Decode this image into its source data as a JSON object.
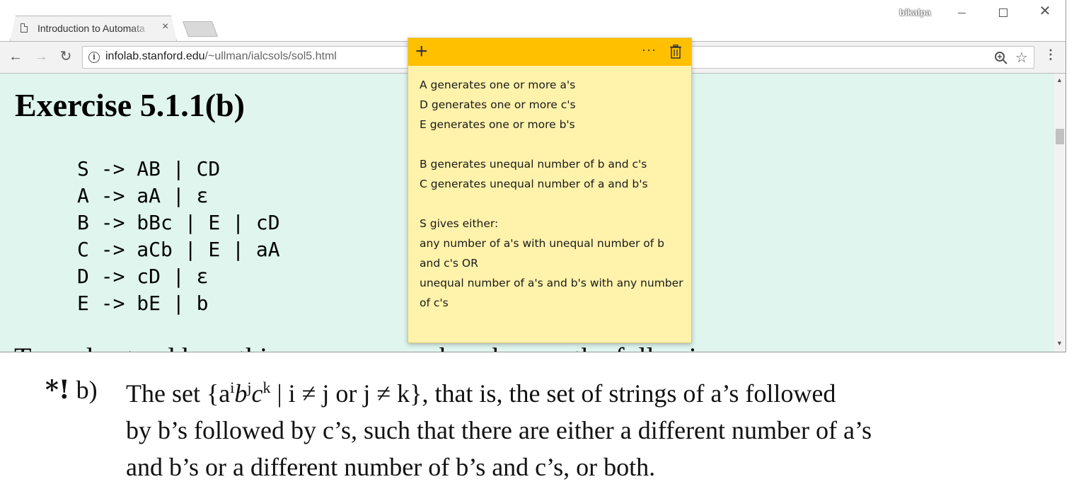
{
  "browser": {
    "tab_title": "Introduction to Automata",
    "tab_close": "×",
    "profile_name": "bikalpa",
    "url_host": "infolab.stanford.edu",
    "url_path": "/~ullman/ialcsols/sol5.html",
    "icons": [
      "back-icon",
      "forward-icon",
      "reload-icon",
      "info-icon",
      "zoom-icon",
      "star-icon",
      "menu-icon"
    ]
  },
  "page": {
    "heading": "Exercise 5.1.1(b)",
    "grammar": [
      "S -> AB | CD",
      "A -> aA | ε",
      "B -> bBc | E | cD",
      "C -> aCb | E | aA",
      "D -> cD | ε",
      "E -> bE | b"
    ],
    "partial_line": "To understand how this grammar works, observe the following:"
  },
  "sticky": {
    "header_color": "#ffc000",
    "body_color": "#fff2ab",
    "lines": [
      "A generates one or more a's",
      "D generates one or more c's",
      "E generates one or more b's",
      "",
      "B generates unequal number of b and c's",
      "C generates unequal number of a and b's",
      "",
      "S gives either:",
      "any number of a's with unequal number of b",
      "and c's OR",
      "unequal number of a's and b's with any number",
      "of c's"
    ]
  },
  "excerpt": {
    "label_marker": "*!",
    "label_letter": "b)",
    "line1_pre": "The set {a",
    "line1_post": " | i ≠ j or j ≠ k}, that is, the set of strings of a’s followed",
    "line2": "by b’s followed by c’s, such that there are either a different number of a’s",
    "line3": "and b’s or a different number of b’s and c’s, or both."
  }
}
